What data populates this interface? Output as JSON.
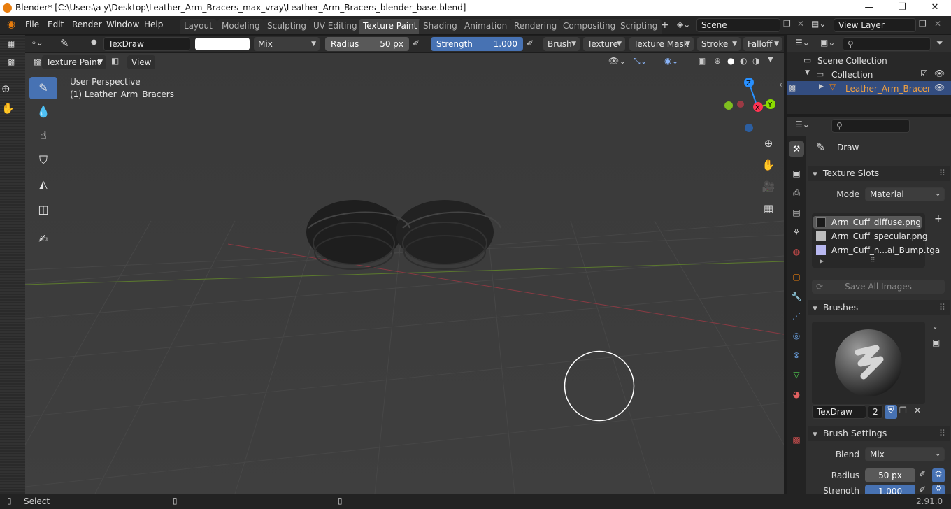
{
  "window": {
    "title": "Blender* [C:\\Users\\a y\\Desktop\\Leather_Arm_Bracers_max_vray\\Leather_Arm_Bracers_blender_base.blend]",
    "minimize": "—",
    "maximize": "❐",
    "close": "✕"
  },
  "menu": {
    "items": [
      "File",
      "Edit",
      "Render",
      "Window",
      "Help"
    ]
  },
  "workspaces": [
    "Layout",
    "Modeling",
    "Sculpting",
    "UV Editing",
    "Texture Paint",
    "Shading",
    "Animation",
    "Rendering",
    "Compositing",
    "Scripting"
  ],
  "workspace_add": "+",
  "scene": {
    "label": "Scene",
    "view_layer": "View Layer"
  },
  "toolheader": {
    "brush_name": "TexDraw",
    "blend": "Mix",
    "radius_label": "Radius",
    "radius_value": "50 px",
    "strength_label": "Strength",
    "strength_value": "1.000",
    "menus": [
      "Brush",
      "Texture",
      "Texture Mask",
      "Stroke",
      "Falloff"
    ]
  },
  "viewport": {
    "mode": "Texture Paint",
    "view_menu": "View",
    "perspective": "User Perspective",
    "object_label": "(1) Leather_Arm_Bracers",
    "gizmo": {
      "z": "Z",
      "x": "X",
      "y": "Y"
    }
  },
  "outliner": {
    "scene_collection": "Scene Collection",
    "collection": "Collection",
    "object": "Leather_Arm_Bracer"
  },
  "properties": {
    "tool_name": "Draw",
    "texture_slots": {
      "header": "Texture Slots",
      "mode_label": "Mode",
      "mode_value": "Material",
      "slots": [
        "Arm_Cuff_diffuse.png",
        "Arm_Cuff_specular.png",
        "Arm_Cuff_n...al_Bump.tga"
      ],
      "save_all": "Save All Images"
    },
    "brushes": {
      "header": "Brushes",
      "brush_name": "TexDraw",
      "users": "2"
    },
    "brush_settings": {
      "header": "Brush Settings",
      "blend_label": "Blend",
      "blend_value": "Mix",
      "radius_label": "Radius",
      "radius_value": "50 px",
      "strength_label": "Strength",
      "strength_value": "1.000"
    }
  },
  "status": {
    "select": "Select",
    "version": "2.91.0"
  },
  "colors": {
    "accent_blue": "#4772b3",
    "x_axis": "#ff3352",
    "y_axis": "#8bdc00",
    "z_axis": "#2890ff",
    "blender_orange": "#e87d0d"
  }
}
